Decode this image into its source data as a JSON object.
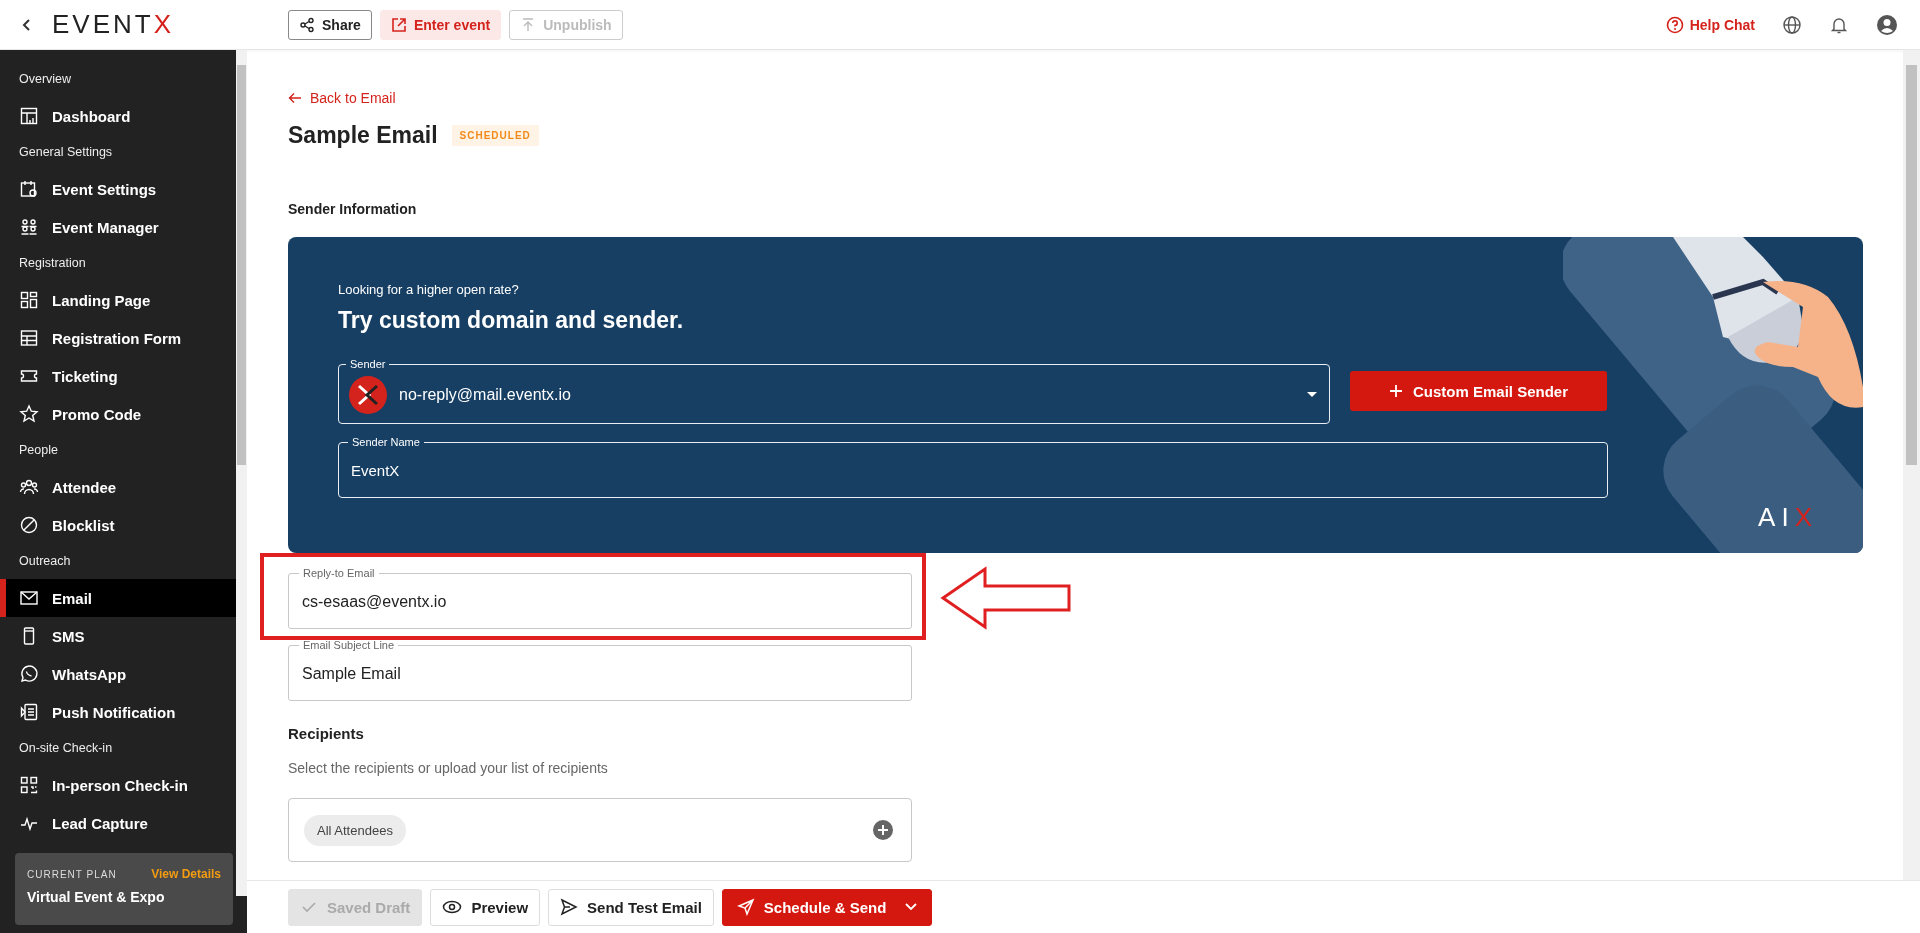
{
  "topbar": {
    "logo": {
      "main": "EVENT",
      "accent": "X"
    },
    "actions": [
      {
        "label": "Share",
        "kind": "share",
        "disabled": false
      },
      {
        "label": "Enter event",
        "kind": "enter",
        "disabled": false
      },
      {
        "label": "Unpublish",
        "kind": "unpublish",
        "disabled": true
      }
    ],
    "help": "Help Chat"
  },
  "sidebar": {
    "sections": [
      {
        "title": "Overview",
        "items": [
          {
            "label": "Dashboard",
            "selected": false
          }
        ]
      },
      {
        "title": "General Settings",
        "items": [
          {
            "label": "Event Settings",
            "selected": false
          },
          {
            "label": "Event Manager",
            "selected": false
          }
        ]
      },
      {
        "title": "Registration",
        "items": [
          {
            "label": "Landing Page",
            "selected": false
          },
          {
            "label": "Registration Form",
            "selected": false
          },
          {
            "label": "Ticketing",
            "selected": false
          },
          {
            "label": "Promo Code",
            "selected": false
          }
        ]
      },
      {
        "title": "People",
        "items": [
          {
            "label": "Attendee",
            "selected": false
          },
          {
            "label": "Blocklist",
            "selected": false
          }
        ]
      },
      {
        "title": "Outreach",
        "items": [
          {
            "label": "Email",
            "selected": true
          },
          {
            "label": "SMS",
            "selected": false
          },
          {
            "label": "WhatsApp",
            "selected": false
          },
          {
            "label": "Push Notification",
            "selected": false
          }
        ]
      },
      {
        "title": "On-site Check-in",
        "items": [
          {
            "label": "In-person Check-in",
            "selected": false
          },
          {
            "label": "Lead Capture",
            "selected": false
          }
        ]
      }
    ],
    "plan": {
      "caption": "CURRENT PLAN",
      "link": "View Details",
      "name": "Virtual Event & Expo"
    }
  },
  "page": {
    "back": "Back to Email",
    "title": "Sample Email",
    "status": "SCHEDULED",
    "section": "Sender Information"
  },
  "promo": {
    "kicker": "Looking for a higher open rate?",
    "headline": "Try custom domain and sender.",
    "sender": {
      "label": "Sender",
      "value": "no-reply@mail.eventx.io"
    },
    "custom_button": "Custom Email Sender",
    "sender_name": {
      "label": "Sender Name",
      "value": "EventX"
    },
    "logo": {
      "main": "AI",
      "accent": "X"
    }
  },
  "fields": [
    {
      "label": "Reply-to Email",
      "value": "cs-esaas@eventx.io",
      "highlighted": true
    },
    {
      "label": "Email Subject Line",
      "value": "Sample Email",
      "highlighted": false
    }
  ],
  "recipients": {
    "title": "Recipients",
    "hint": "Select the recipients or upload your list of recipients",
    "chips": [
      "All Attendees"
    ]
  },
  "footer": {
    "buttons": [
      {
        "label": "Saved Draft",
        "kind": "draft",
        "disabled": true
      },
      {
        "label": "Preview",
        "kind": "preview",
        "disabled": false
      },
      {
        "label": "Send Test Email",
        "kind": "test",
        "disabled": false
      },
      {
        "label": "Schedule & Send",
        "kind": "primary",
        "disabled": false
      }
    ]
  }
}
